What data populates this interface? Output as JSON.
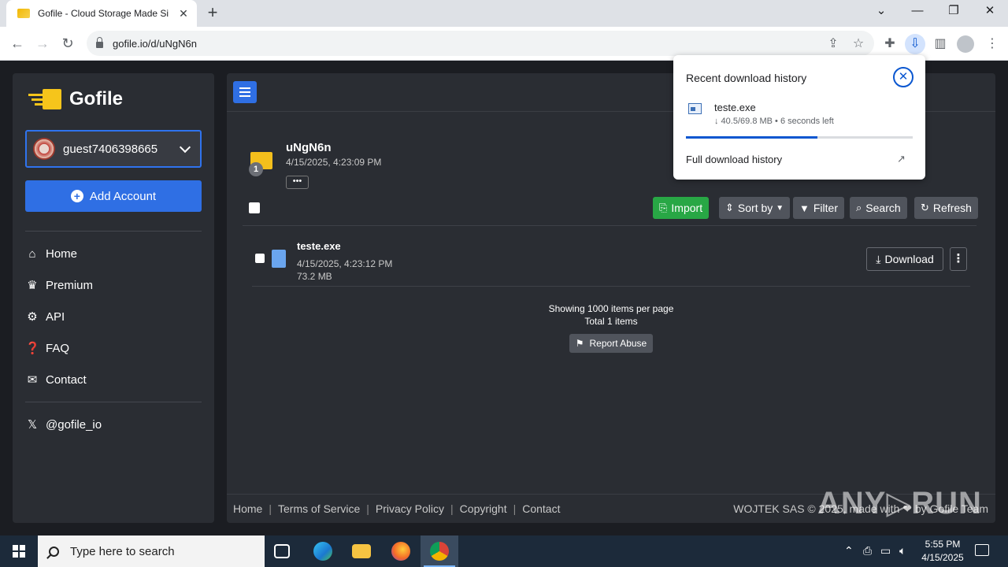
{
  "browser": {
    "tab_title": "Gofile - Cloud Storage Made Si",
    "url": "gofile.io/d/uNgN6n"
  },
  "sidebar": {
    "brand": "Gofile",
    "account_name": "guest7406398665",
    "add_account_label": "Add Account",
    "nav": [
      {
        "label": "Home",
        "icon": "home-icon"
      },
      {
        "label": "Premium",
        "icon": "crown-icon"
      },
      {
        "label": "API",
        "icon": "cogs-icon"
      },
      {
        "label": "FAQ",
        "icon": "question-icon"
      },
      {
        "label": "Contact",
        "icon": "envelope-icon"
      }
    ],
    "social": "@gofile_io"
  },
  "folder": {
    "name": "uNgN6n",
    "date": "4/15/2025, 4:23:09 PM",
    "item_count": "1",
    "more_label": "•••"
  },
  "actions": {
    "import": "Import",
    "sort": "Sort by",
    "filter": "Filter",
    "search": "Search",
    "refresh": "Refresh"
  },
  "files": [
    {
      "name": "teste.exe",
      "date": "4/15/2025, 4:23:12 PM",
      "size": "73.2 MB",
      "download_label": "Download"
    }
  ],
  "listing": {
    "per_page": "Showing 1000 items per page",
    "total": "Total 1 items",
    "report": "Report Abuse"
  },
  "footer": {
    "links": [
      "Home",
      "Terms of Service",
      "Privacy Policy",
      "Copyright",
      "Contact"
    ],
    "right": "WOJTEK SAS © 2025, made with ❤ by Gofile Team"
  },
  "download_popup": {
    "title": "Recent download history",
    "filename": "teste.exe",
    "status": "↓ 40.5/69.8 MB • 6 seconds left",
    "progress": 0.58,
    "full_history": "Full download history"
  },
  "watermark": "ANY▷RUN",
  "taskbar": {
    "search_placeholder": "Type here to search",
    "time": "5:55 PM",
    "date": "4/15/2025"
  },
  "colors": {
    "accent_blue": "#2f6fe4",
    "import_green": "#28a745",
    "folder_yellow": "#f4bf1c",
    "panel_bg": "#2a2d33"
  }
}
